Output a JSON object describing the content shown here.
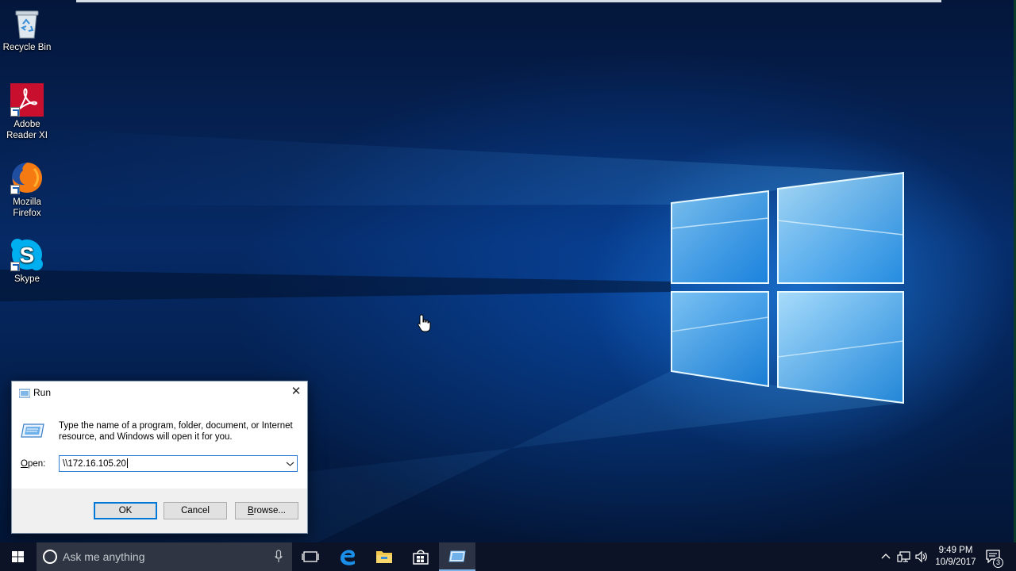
{
  "desktop": {
    "icons": [
      {
        "label": "Recycle Bin",
        "icon": "recycle-bin-icon"
      },
      {
        "label": "Adobe Reader XI",
        "icon": "adobe-reader-icon"
      },
      {
        "label": "Mozilla Firefox",
        "icon": "firefox-icon"
      },
      {
        "label": "Skype",
        "icon": "skype-icon"
      }
    ]
  },
  "run_dialog": {
    "title": "Run",
    "description": "Type the name of a program, folder, document, or Internet resource, and Windows will open it for you.",
    "open_label_prefix": "O",
    "open_label_rest": "pen:",
    "open_value": "\\\\172.16.105.20",
    "buttons": {
      "ok": "OK",
      "cancel": "Cancel",
      "browse_prefix": "B",
      "browse_rest": "rowse..."
    }
  },
  "taskbar": {
    "search_placeholder": "Ask me anything",
    "pinned": [
      "task-view-icon",
      "edge-icon",
      "file-explorer-icon",
      "store-icon",
      "run-icon"
    ],
    "clock": {
      "time": "9:49 PM",
      "date": "10/9/2017"
    },
    "notification_count": "3"
  },
  "colors": {
    "accent": "#0078d7",
    "taskbar": "#0c1326",
    "search_box": "#2f3542",
    "wallpaper_glow": "#2ea8ff"
  }
}
